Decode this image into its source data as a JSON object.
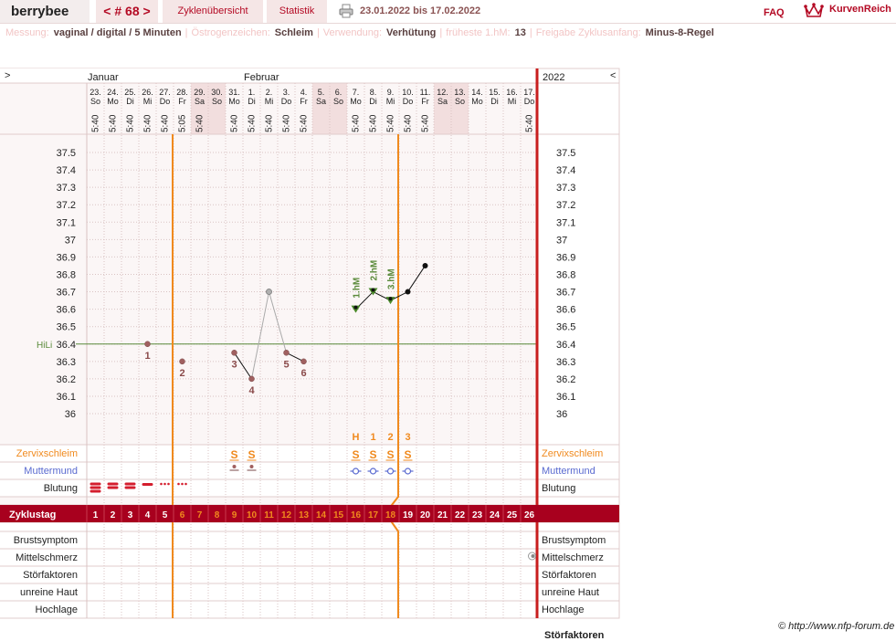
{
  "header": {
    "brand": "berrybee",
    "cycle_nav": "< # 68 >",
    "overview_tab": "Zyklenübersicht",
    "stats_tab": "Statistik",
    "date_range": "23.01.2022 bis 17.02.2022",
    "faq": "FAQ",
    "logo_text": "KurvenReich"
  },
  "settings": [
    {
      "label": "Messung:",
      "value": "vaginal / digital / 5 Minuten"
    },
    {
      "label": "Östrogenzeichen:",
      "value": "Schleim"
    },
    {
      "label": "Verwendung:",
      "value": "Verhütung"
    },
    {
      "label": "früheste 1.hM:",
      "value": "13"
    },
    {
      "label": "Freigabe Zyklusanfang:",
      "value": "Minus-8-Regel"
    }
  ],
  "chart_data": {
    "type": "line",
    "nav_prev": ">",
    "nav_next": "<",
    "year": "2022",
    "month_labels": [
      {
        "day_index": 1,
        "label": "Januar"
      },
      {
        "day_index": 10,
        "label": "Februar"
      }
    ],
    "days": [
      {
        "date": "23.",
        "weekday": "So",
        "time": "5:40",
        "weekend": false
      },
      {
        "date": "24.",
        "weekday": "Mo",
        "time": "5:40",
        "weekend": false
      },
      {
        "date": "25.",
        "weekday": "Di",
        "time": "5:40",
        "weekend": false
      },
      {
        "date": "26.",
        "weekday": "Mi",
        "time": "5:40",
        "weekend": false
      },
      {
        "date": "27.",
        "weekday": "Do",
        "time": "5:40",
        "weekend": false
      },
      {
        "date": "28.",
        "weekday": "Fr",
        "time": "5:05",
        "weekend": false
      },
      {
        "date": "29.",
        "weekday": "Sa",
        "time": "5:40",
        "weekend": true
      },
      {
        "date": "30.",
        "weekday": "So",
        "time": "",
        "weekend": true
      },
      {
        "date": "31.",
        "weekday": "Mo",
        "time": "5:40",
        "weekend": false
      },
      {
        "date": "1.",
        "weekday": "Di",
        "time": "5:40",
        "weekend": false
      },
      {
        "date": "2.",
        "weekday": "Mi",
        "time": "5:40",
        "weekend": false
      },
      {
        "date": "3.",
        "weekday": "Do",
        "time": "5:40",
        "weekend": false
      },
      {
        "date": "4.",
        "weekday": "Fr",
        "time": "5:40",
        "weekend": false
      },
      {
        "date": "5.",
        "weekday": "Sa",
        "time": "",
        "weekend": true
      },
      {
        "date": "6.",
        "weekday": "So",
        "time": "",
        "weekend": true
      },
      {
        "date": "7.",
        "weekday": "Mo",
        "time": "5:40",
        "weekend": false
      },
      {
        "date": "8.",
        "weekday": "Di",
        "time": "5:40",
        "weekend": false
      },
      {
        "date": "9.",
        "weekday": "Mi",
        "time": "5:40",
        "weekend": false
      },
      {
        "date": "10.",
        "weekday": "Do",
        "time": "5:40",
        "weekend": false
      },
      {
        "date": "11.",
        "weekday": "Fr",
        "time": "5:40",
        "weekend": false
      },
      {
        "date": "12.",
        "weekday": "Sa",
        "time": "",
        "weekend": true
      },
      {
        "date": "13.",
        "weekday": "So",
        "time": "",
        "weekend": true
      },
      {
        "date": "14.",
        "weekday": "Mo",
        "time": "",
        "weekend": false
      },
      {
        "date": "15.",
        "weekday": "Di",
        "time": "",
        "weekend": false
      },
      {
        "date": "16.",
        "weekday": "Mi",
        "time": "",
        "weekend": false
      },
      {
        "date": "17.",
        "weekday": "Do",
        "time": "5:40",
        "weekend": false
      }
    ],
    "y_ticks": [
      "37.5",
      "37.4",
      "37.3",
      "37.2",
      "37.1",
      "37",
      "36.9",
      "36.8",
      "36.7",
      "36.6",
      "36.5",
      "36.4",
      "36.3",
      "36.2",
      "36.1",
      "36"
    ],
    "ylim": [
      36.0,
      37.5
    ],
    "hili": {
      "label": "HiLi",
      "value": 36.4
    },
    "temperatures": [
      {
        "day": 4,
        "value": 36.4,
        "label": "1"
      },
      {
        "day": 6,
        "value": 36.3,
        "label": "2"
      },
      {
        "day": 9,
        "value": 36.35,
        "label": "3"
      },
      {
        "day": 10,
        "value": 36.2,
        "label": "4"
      },
      {
        "day": 11,
        "value": 36.7,
        "label": "",
        "excluded": true
      },
      {
        "day": 12,
        "value": 36.35,
        "label": "5"
      },
      {
        "day": 13,
        "value": 36.3,
        "label": "6"
      },
      {
        "day": 16,
        "value": 36.6,
        "label": "1.hM",
        "hm": true
      },
      {
        "day": 17,
        "value": 36.7,
        "label": "2.hM",
        "hm": true
      },
      {
        "day": 18,
        "value": 36.65,
        "label": "3.hM",
        "hm": true
      },
      {
        "day": 19,
        "value": 36.7,
        "label": ""
      },
      {
        "day": 20,
        "value": 36.85,
        "label": ""
      }
    ],
    "segments": [
      [
        9,
        10
      ],
      [
        12,
        13
      ],
      [
        16,
        17
      ],
      [
        17,
        18
      ],
      [
        18,
        19
      ],
      [
        19,
        20
      ]
    ],
    "excluded_segments": [
      [
        10,
        11
      ],
      [
        11,
        12
      ]
    ],
    "mucus_peak_counts": [
      {
        "day": 16,
        "label": "H"
      },
      {
        "day": 17,
        "label": "1"
      },
      {
        "day": 18,
        "label": "2"
      },
      {
        "day": 19,
        "label": "3"
      }
    ],
    "mucus": [
      {
        "day": 9,
        "value": "S"
      },
      {
        "day": 10,
        "value": "S"
      },
      {
        "day": 16,
        "value": "S"
      },
      {
        "day": 17,
        "value": "S"
      },
      {
        "day": 18,
        "value": "S"
      },
      {
        "day": 19,
        "value": "S"
      }
    ],
    "cervix_dot_days": [
      9,
      10
    ],
    "cervix_circle_days": [
      16,
      17,
      18,
      19
    ],
    "bleeding": [
      {
        "day": 1,
        "level": "heavy"
      },
      {
        "day": 2,
        "level": "medium"
      },
      {
        "day": 3,
        "level": "medium"
      },
      {
        "day": 4,
        "level": "light"
      },
      {
        "day": 5,
        "level": "spotting"
      },
      {
        "day": 6,
        "level": "spotting"
      }
    ],
    "rows": {
      "cervical_mucus": "Zervixschleim",
      "cervix": "Muttermund",
      "bleeding": "Blutung",
      "cycle_day": "Zyklustag",
      "breast": "Brustsymptom",
      "midpain": "Mittelschmerz",
      "disruptions": "Störfaktoren",
      "skin": "unreine Haut",
      "mood": "Hochlage"
    },
    "cycle_days": [
      "1",
      "2",
      "3",
      "4",
      "5",
      "6",
      "7",
      "8",
      "9",
      "10",
      "11",
      "12",
      "13",
      "14",
      "15",
      "16",
      "17",
      "18",
      "19",
      "20",
      "21",
      "22",
      "23",
      "24",
      "25",
      "26"
    ],
    "infertile_until_day": 5,
    "fertile_start_line_day": 5,
    "fertile_end_line_day": 18,
    "midpain_day": 26
  },
  "footer": {
    "copyright": "© http://www.nfp-forum.de",
    "cut_label": "Störfaktoren"
  },
  "colors": {
    "accent": "#b40a24",
    "orange": "#f08a1e",
    "green": "#5a8a3a",
    "hm_fill": "#4a8a2a",
    "blue": "#5a6ad0",
    "temp_dot": "#a06060"
  }
}
